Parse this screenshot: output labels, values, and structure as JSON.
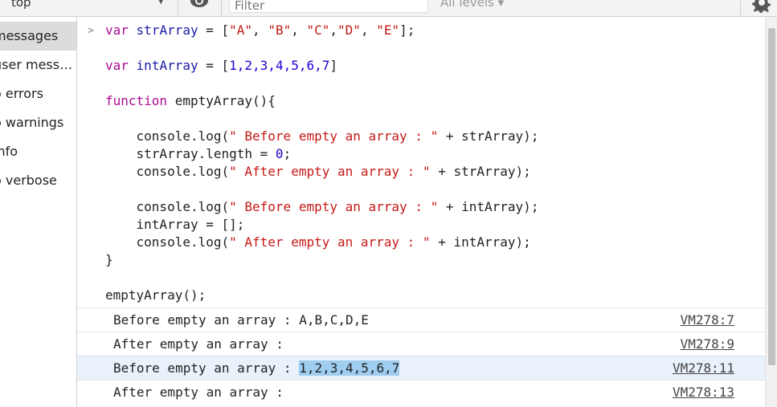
{
  "toolbar": {
    "context": "top",
    "filter_placeholder": "Filter",
    "levels_label": "All levels ▾"
  },
  "sidebar": {
    "items": [
      {
        "label": "messages",
        "active": true
      },
      {
        "label": "user mess…",
        "active": false
      },
      {
        "label": "o errors",
        "active": false
      },
      {
        "label": "o warnings",
        "active": false
      },
      {
        "label": "info",
        "active": false
      },
      {
        "label": "o verbose",
        "active": false
      }
    ]
  },
  "console": {
    "prompt": ">",
    "code": {
      "l1_kw": "var",
      "l1_name": "strArray",
      "l1_eq": " = [",
      "l1_a": "\"A\"",
      "l1_b": "\"B\"",
      "l1_c": "\"C\"",
      "l1_d": "\"D\"",
      "l1_e": "\"E\"",
      "l1_end": "];",
      "l2_kw": "var",
      "l2_name": "intArray",
      "l2_eq": " = [",
      "l2_vals": "1,2,3,4,5,6,7",
      "l2_end": "]",
      "l3_kw": "function",
      "l3_rest": " emptyArray(){",
      "l4_a": "    console.log(",
      "l4_str": "\" Before empty an array : \"",
      "l4_b": " + strArray);",
      "l5_a": "    strArray.length = ",
      "l5_num": "0",
      "l5_b": ";",
      "l6_a": "    console.log(",
      "l6_str": "\" After empty an array : \"",
      "l6_b": " + strArray);",
      "l7_a": "    console.log(",
      "l7_str": "\" Before empty an array : \"",
      "l7_b": " + intArray);",
      "l8": "    intArray = [];",
      "l9_a": "    console.log(",
      "l9_str": "\" After empty an array : \"",
      "l9_b": " + intArray);",
      "l10": "}",
      "l11": "emptyArray();"
    },
    "logs": [
      {
        "text": "Before empty an array : A,B,C,D,E",
        "sel": "",
        "source": "VM278:7"
      },
      {
        "text": "After empty an array : ",
        "sel": "",
        "source": "VM278:9"
      },
      {
        "text": "Before empty an array : ",
        "sel": "1,2,3,4,5,6,7",
        "source": "VM278:11"
      },
      {
        "text": "After empty an array : ",
        "sel": "",
        "source": "VM278:13"
      }
    ]
  },
  "colors": {
    "keyword": "#a90d91",
    "variable": "#1a1aa6",
    "string": "#c41a16",
    "number": "#1c00cf",
    "selection": "#9fcdf0"
  },
  "icons": [
    "chevron-down-icon",
    "eye-icon",
    "gear-icon",
    "prompt-chevron-icon"
  ]
}
